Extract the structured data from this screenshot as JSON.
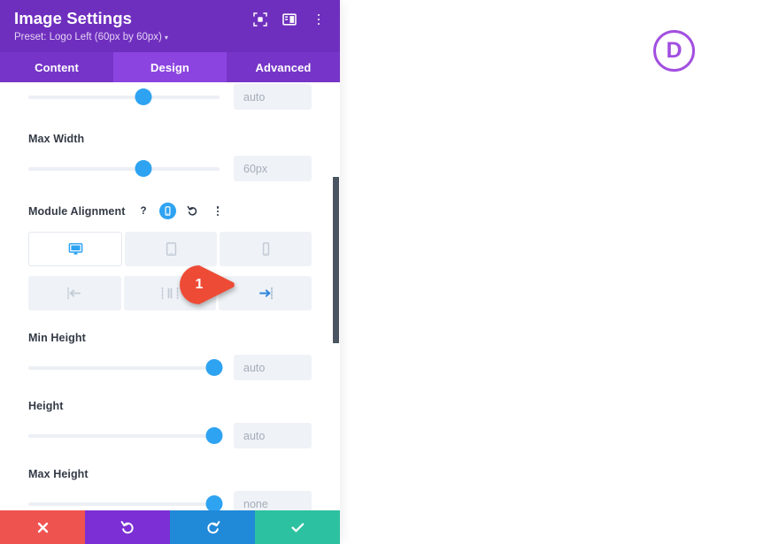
{
  "panel": {
    "title": "Image Settings",
    "preset": "Preset: Logo Left (60px by 60px)",
    "preset_caret": "▾",
    "header_icons": [
      {
        "name": "focus-target-icon",
        "label": "Focus"
      },
      {
        "name": "layout-panel-icon",
        "label": "Panel Layout"
      },
      {
        "name": "more-vertical-icon",
        "label": "More Options"
      }
    ],
    "tabs": [
      {
        "label": "Content",
        "active": false
      },
      {
        "label": "Design",
        "active": true
      },
      {
        "label": "Advanced",
        "active": false
      }
    ],
    "fields": [
      {
        "label": "",
        "value": "auto",
        "slider_pct": 60,
        "partial": true
      },
      {
        "label": "Max Width",
        "value": "60px",
        "slider_pct": 60,
        "partial": false
      },
      {
        "label": "Min Height",
        "value": "auto",
        "slider_pct": 97,
        "partial": false
      },
      {
        "label": "Height",
        "value": "auto",
        "slider_pct": 97,
        "partial": false
      },
      {
        "label": "Max Height",
        "value": "none",
        "slider_pct": 97,
        "partial": false
      }
    ],
    "module_alignment": {
      "label": "Module Alignment",
      "controls": [
        {
          "name": "help-icon",
          "glyph": "?",
          "active": false
        },
        {
          "name": "responsive-mobile-icon",
          "glyph": "",
          "active": true
        },
        {
          "name": "reset-icon",
          "glyph": "↺",
          "active": false
        },
        {
          "name": "more-vertical-icon",
          "glyph": "",
          "active": false
        }
      ],
      "devices": [
        {
          "name": "desktop-icon",
          "label": "Desktop",
          "active": true
        },
        {
          "name": "tablet-icon",
          "label": "Tablet",
          "active": false
        },
        {
          "name": "phone-icon",
          "label": "Phone",
          "active": false
        }
      ],
      "alignments": [
        {
          "name": "align-left-icon",
          "label": "Left",
          "active": false
        },
        {
          "name": "align-center-icon",
          "label": "Center",
          "active": false
        },
        {
          "name": "align-right-icon",
          "label": "Right",
          "active": true
        }
      ]
    },
    "footer_actions": [
      {
        "name": "close-button",
        "label": "Close",
        "color": "#ef5350"
      },
      {
        "name": "undo-button",
        "label": "Undo",
        "color": "#7b2fd4"
      },
      {
        "name": "redo-button",
        "label": "Redo",
        "color": "#2089d8"
      },
      {
        "name": "save-button",
        "label": "Save",
        "color": "#2cc1a0"
      }
    ],
    "scrollbar": {
      "top_pct": 22,
      "height_pct": 39
    }
  },
  "marker": {
    "number": "1",
    "color": "#ee4b36"
  },
  "divi_logo": {
    "letter": "D",
    "color": "#a24fe0"
  }
}
